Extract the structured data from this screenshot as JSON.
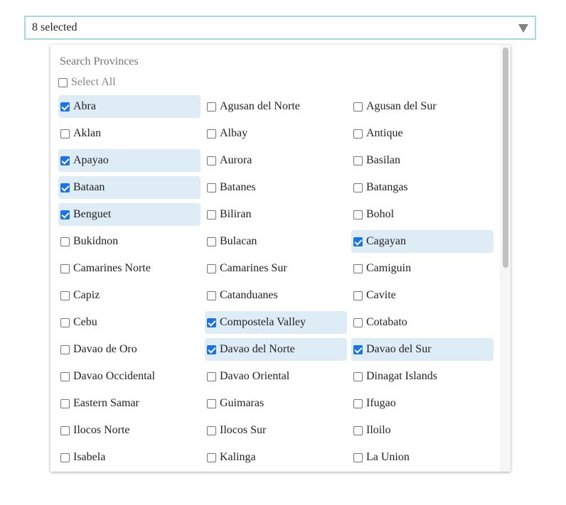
{
  "select": {
    "value": "8 selected"
  },
  "dropdown": {
    "search_placeholder": "Search Provinces",
    "select_all_label": "Select All",
    "options": [
      {
        "label": "Abra",
        "checked": true
      },
      {
        "label": "Agusan del Norte",
        "checked": false
      },
      {
        "label": "Agusan del Sur",
        "checked": false
      },
      {
        "label": "Aklan",
        "checked": false
      },
      {
        "label": "Albay",
        "checked": false
      },
      {
        "label": "Antique",
        "checked": false
      },
      {
        "label": "Apayao",
        "checked": true
      },
      {
        "label": "Aurora",
        "checked": false
      },
      {
        "label": "Basilan",
        "checked": false
      },
      {
        "label": "Bataan",
        "checked": true
      },
      {
        "label": "Batanes",
        "checked": false
      },
      {
        "label": "Batangas",
        "checked": false
      },
      {
        "label": "Benguet",
        "checked": true
      },
      {
        "label": "Biliran",
        "checked": false
      },
      {
        "label": "Bohol",
        "checked": false
      },
      {
        "label": "Bukidnon",
        "checked": false
      },
      {
        "label": "Bulacan",
        "checked": false
      },
      {
        "label": "Cagayan",
        "checked": true
      },
      {
        "label": "Camarines Norte",
        "checked": false
      },
      {
        "label": "Camarines Sur",
        "checked": false
      },
      {
        "label": "Camiguin",
        "checked": false
      },
      {
        "label": "Capiz",
        "checked": false
      },
      {
        "label": "Catanduanes",
        "checked": false
      },
      {
        "label": "Cavite",
        "checked": false
      },
      {
        "label": "Cebu",
        "checked": false
      },
      {
        "label": "Compostela Valley",
        "checked": true
      },
      {
        "label": "Cotabato",
        "checked": false
      },
      {
        "label": "Davao de Oro",
        "checked": false
      },
      {
        "label": "Davao del Norte",
        "checked": true
      },
      {
        "label": "Davao del Sur",
        "checked": true
      },
      {
        "label": "Davao Occidental",
        "checked": false
      },
      {
        "label": "Davao Oriental",
        "checked": false
      },
      {
        "label": "Dinagat Islands",
        "checked": false
      },
      {
        "label": "Eastern Samar",
        "checked": false
      },
      {
        "label": "Guimaras",
        "checked": false
      },
      {
        "label": "Ifugao",
        "checked": false
      },
      {
        "label": "Ilocos Norte",
        "checked": false
      },
      {
        "label": "Ilocos Sur",
        "checked": false
      },
      {
        "label": "Iloilo",
        "checked": false
      },
      {
        "label": "Isabela",
        "checked": false
      },
      {
        "label": "Kalinga",
        "checked": false
      },
      {
        "label": "La Union",
        "checked": false
      }
    ]
  },
  "colors": {
    "select_border": "#a8dadc",
    "checked_bg": "#deecf6",
    "checkbox_accent": "#1a73e8"
  }
}
